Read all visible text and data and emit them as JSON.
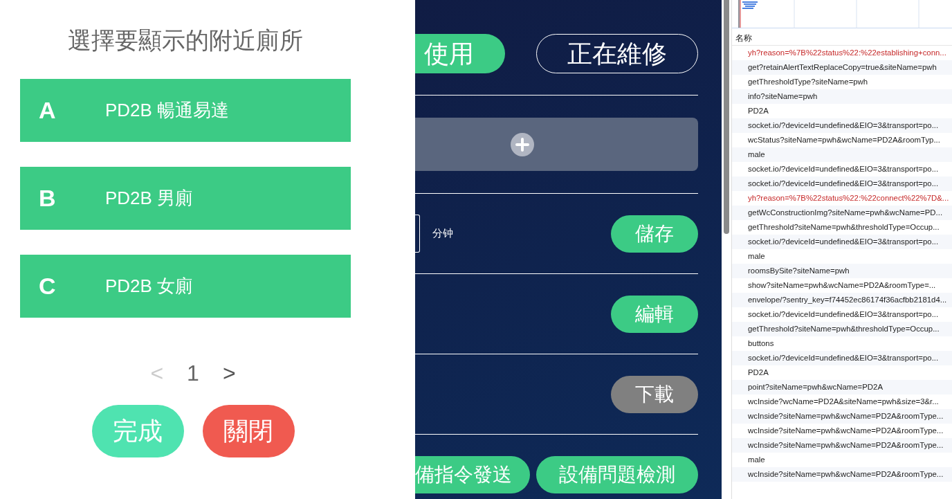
{
  "dialog": {
    "title": "選擇要顯示的附近廁所",
    "items": [
      {
        "letter": "A",
        "label": "PD2B 暢通易達"
      },
      {
        "letter": "B",
        "label": "PD2B 男廁"
      },
      {
        "letter": "C",
        "label": "PD2B 女廁"
      }
    ],
    "pagination": {
      "prev": "<",
      "page": "1",
      "next": ">",
      "prev_disabled": true
    },
    "buttons": [
      {
        "label": "完成",
        "kind": "confirm"
      },
      {
        "label": "關閉",
        "kind": "close"
      }
    ]
  },
  "background": {
    "status_buttons": [
      {
        "label": "使用",
        "selected": true
      },
      {
        "label": "正在維修",
        "selected": false
      }
    ],
    "unit": "分钟",
    "actions": [
      {
        "label": "儲存",
        "disabled": false
      },
      {
        "label": "編輯",
        "disabled": false
      },
      {
        "label": "下載",
        "disabled": true
      }
    ],
    "bottom_buttons": [
      "備指令發送",
      "設備問題檢測"
    ]
  },
  "devtools": {
    "column_header": "名称",
    "requests": [
      {
        "name": "yh?reason=%7B%22status%22:%22establishing+conn...",
        "failed": true
      },
      {
        "name": "get?retainAlertTextReplaceCopy=true&siteName=pwh",
        "failed": false
      },
      {
        "name": "getThresholdType?siteName=pwh",
        "failed": false
      },
      {
        "name": "info?siteName=pwh",
        "failed": false
      },
      {
        "name": "PD2A",
        "failed": false
      },
      {
        "name": "socket.io/?deviceId=undefined&EIO=3&transport=po...",
        "failed": false
      },
      {
        "name": "wcStatus?siteName=pwh&wcName=PD2A&roomTyp...",
        "failed": false
      },
      {
        "name": "male",
        "failed": false
      },
      {
        "name": "socket.io/?deviceId=undefined&EIO=3&transport=po...",
        "failed": false
      },
      {
        "name": "socket.io/?deviceId=undefined&EIO=3&transport=po...",
        "failed": false
      },
      {
        "name": "yh?reason=%7B%22status%22:%22connect%22%7D&...",
        "failed": true
      },
      {
        "name": "getWcConstructionImg?siteName=pwh&wcName=PD...",
        "failed": false
      },
      {
        "name": "getThreshold?siteName=pwh&thresholdType=Occup...",
        "failed": false
      },
      {
        "name": "socket.io/?deviceId=undefined&EIO=3&transport=po...",
        "failed": false
      },
      {
        "name": "male",
        "failed": false
      },
      {
        "name": "roomsBySite?siteName=pwh",
        "failed": false
      },
      {
        "name": "show?siteName=pwh&wcName=PD2A&roomType=...",
        "failed": false
      },
      {
        "name": "envelope/?sentry_key=f74452ec86174f36acfbb2181d4...",
        "failed": false
      },
      {
        "name": "socket.io/?deviceId=undefined&EIO=3&transport=po...",
        "failed": false
      },
      {
        "name": "getThreshold?siteName=pwh&thresholdType=Occup...",
        "failed": false
      },
      {
        "name": "buttons",
        "failed": false
      },
      {
        "name": "socket.io/?deviceId=undefined&EIO=3&transport=po...",
        "failed": false
      },
      {
        "name": "PD2A",
        "failed": false
      },
      {
        "name": "point?siteName=pwh&wcName=PD2A",
        "failed": false
      },
      {
        "name": "wcInside?wcName=PD2A&siteName=pwh&size=3&r...",
        "failed": false
      },
      {
        "name": "wcInside?siteName=pwh&wcName=PD2A&roomType...",
        "failed": false
      },
      {
        "name": "wcInside?siteName=pwh&wcName=PD2A&roomType...",
        "failed": false
      },
      {
        "name": "wcInside?siteName=pwh&wcName=PD2A&roomType...",
        "failed": false
      },
      {
        "name": "male",
        "failed": false
      },
      {
        "name": "wcInside?siteName=pwh&wcName=PD2A&roomType...",
        "failed": false
      }
    ]
  }
}
